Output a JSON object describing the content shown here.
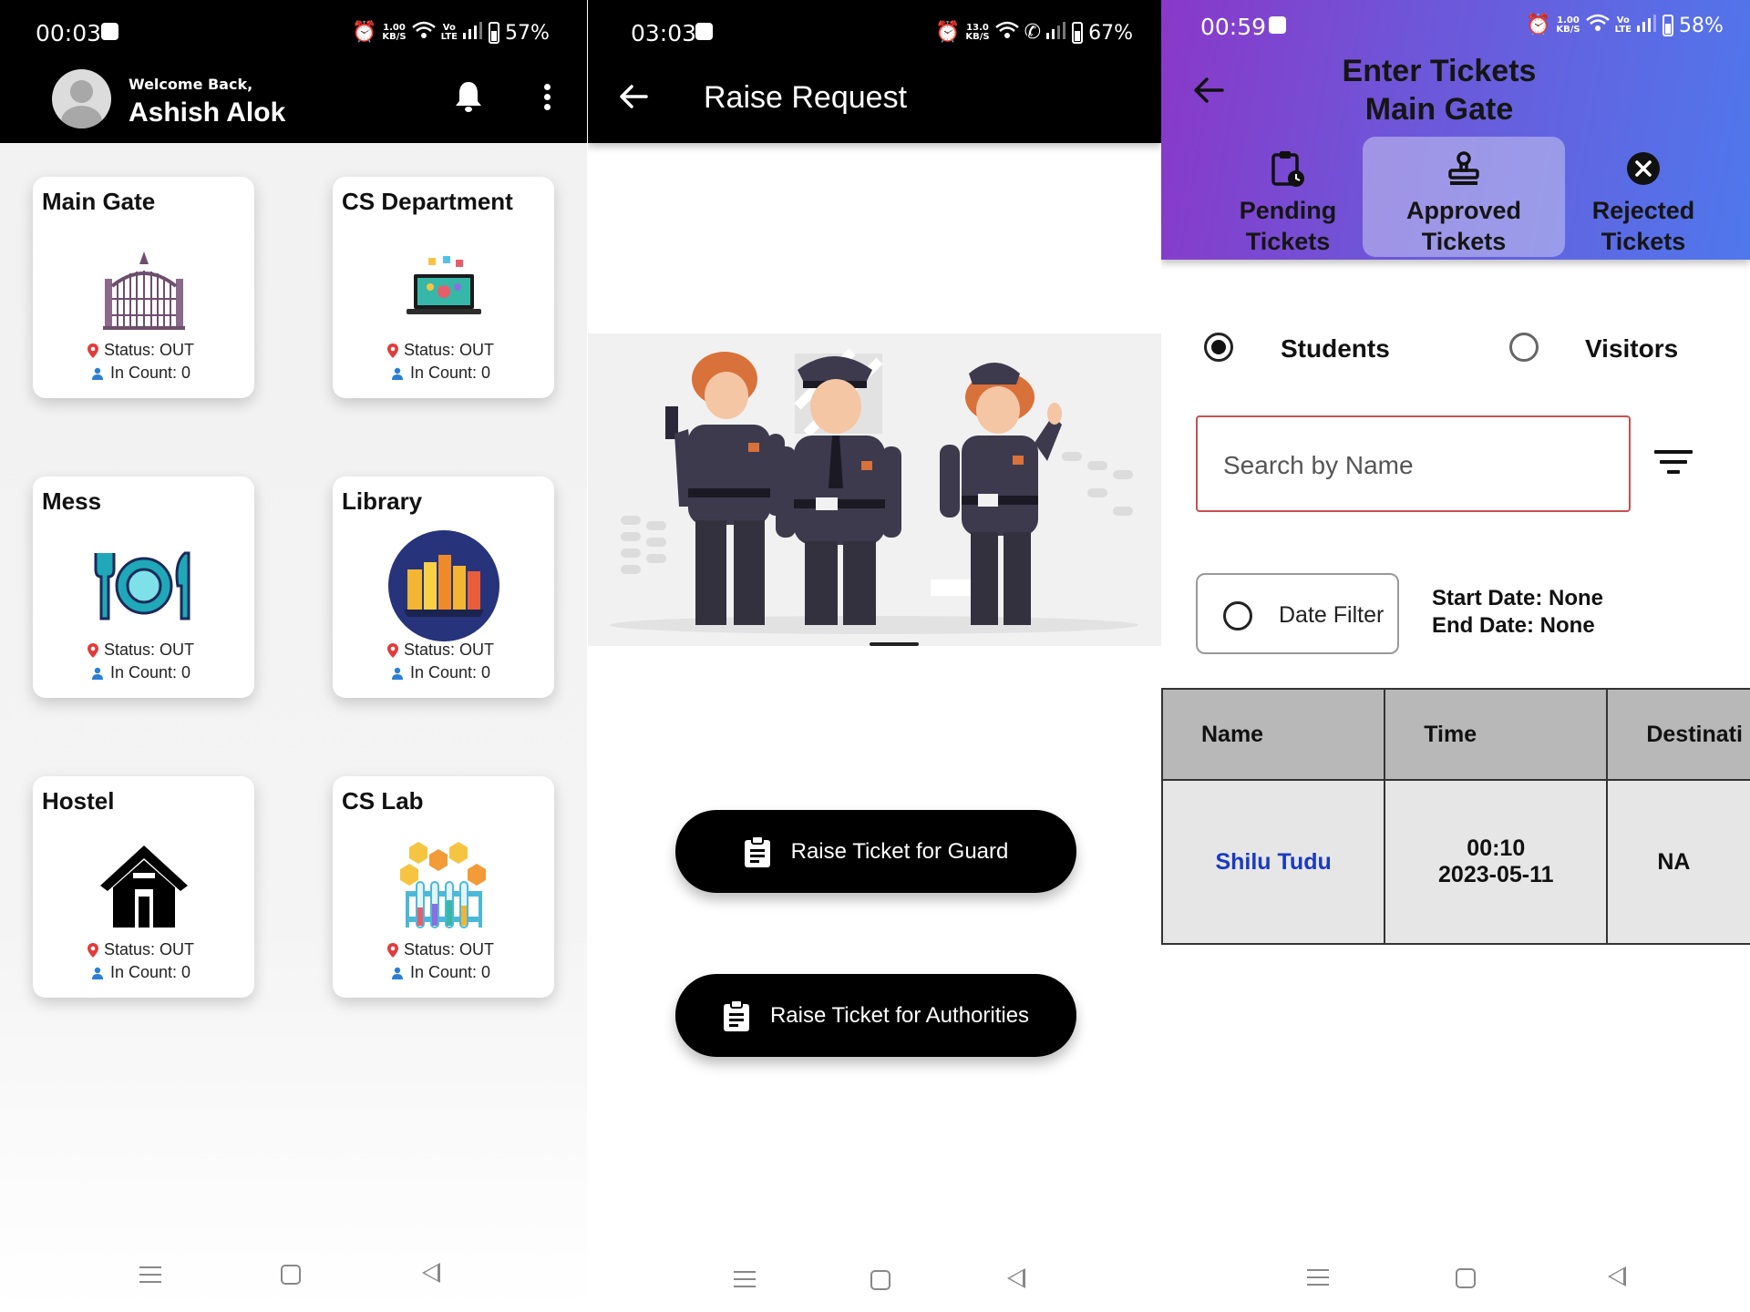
{
  "screen1": {
    "status_time": "00:03",
    "status_speed_top": "1.00",
    "status_speed_unit": "KB/S",
    "status_battery": "57%",
    "welcome": "Welcome Back,",
    "username": "Ashish Alok",
    "cards": [
      {
        "title": "Main Gate",
        "status": "Status: OUT",
        "count": "In Count: 0",
        "icon": "gate-icon"
      },
      {
        "title": "CS Department",
        "status": "Status: OUT",
        "count": "In Count: 0",
        "icon": "laptop-icon"
      },
      {
        "title": "Mess",
        "status": "Status: OUT",
        "count": "In Count: 0",
        "icon": "plate-icon"
      },
      {
        "title": "Library",
        "status": "Status: OUT",
        "count": "In Count: 0",
        "icon": "books-icon"
      },
      {
        "title": "Hostel",
        "status": "Status: OUT",
        "count": "In Count: 0",
        "icon": "house-icon"
      },
      {
        "title": "CS Lab",
        "status": "Status: OUT",
        "count": "In Count: 0",
        "icon": "lab-icon"
      }
    ]
  },
  "screen2": {
    "status_time": "03:03",
    "status_speed_top": "13.0",
    "status_speed_unit": "KB/S",
    "status_battery": "67%",
    "title": "Raise Request",
    "btn_guard": "Raise Ticket for Guard",
    "btn_authorities": "Raise Ticket for Authorities"
  },
  "screen3": {
    "status_time": "00:59",
    "status_speed_top": "1.00",
    "status_speed_unit": "KB/S",
    "status_battery": "58%",
    "title_line1": "Enter Tickets",
    "title_line2": "Main Gate",
    "tabs": [
      {
        "line1": "Pending",
        "line2": "Tickets"
      },
      {
        "line1": "Approved",
        "line2": "Tickets"
      },
      {
        "line1": "Rejected",
        "line2": "Tickets"
      }
    ],
    "radio_students": "Students",
    "radio_visitors": "Visitors",
    "search_placeholder": "Search by Name",
    "date_filter_label": "Date Filter",
    "start_date": "Start Date: None",
    "end_date": "End Date: None",
    "table": {
      "headers": [
        "Name",
        "Time",
        "Destinati"
      ],
      "rows": [
        {
          "name": "Shilu Tudu",
          "time_line1": "00:10",
          "time_line2": "2023-05-11",
          "destination": "NA"
        }
      ]
    }
  },
  "colors": {
    "header_black": "#000000",
    "purple_start": "#8a38c8",
    "blue_end": "#4f78ec",
    "search_border": "#c75050",
    "link_blue": "#1a3ac0"
  }
}
